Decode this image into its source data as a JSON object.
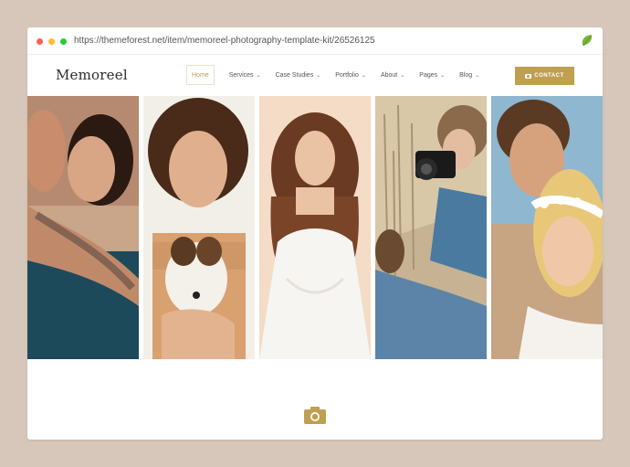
{
  "browser": {
    "url": "https://themeforest.net/item/memoreel-photography-template-kit/26526125"
  },
  "site": {
    "logo": "Memoreel",
    "nav": [
      {
        "label": "Home",
        "active": true
      },
      {
        "label": "Services",
        "dropdown": true
      },
      {
        "label": "Case Studies",
        "dropdown": true
      },
      {
        "label": "Portfolio",
        "dropdown": true
      },
      {
        "label": "About",
        "dropdown": true
      },
      {
        "label": "Pages",
        "dropdown": true
      },
      {
        "label": "Blog",
        "dropdown": true
      }
    ],
    "contact_label": "CONTACT",
    "accent_color": "#bf9f50"
  },
  "gallery": [
    {
      "subject": "couple embracing"
    },
    {
      "subject": "woman with dog"
    },
    {
      "subject": "bride"
    },
    {
      "subject": "photographer with camera"
    },
    {
      "subject": "couple with flower crown"
    }
  ]
}
